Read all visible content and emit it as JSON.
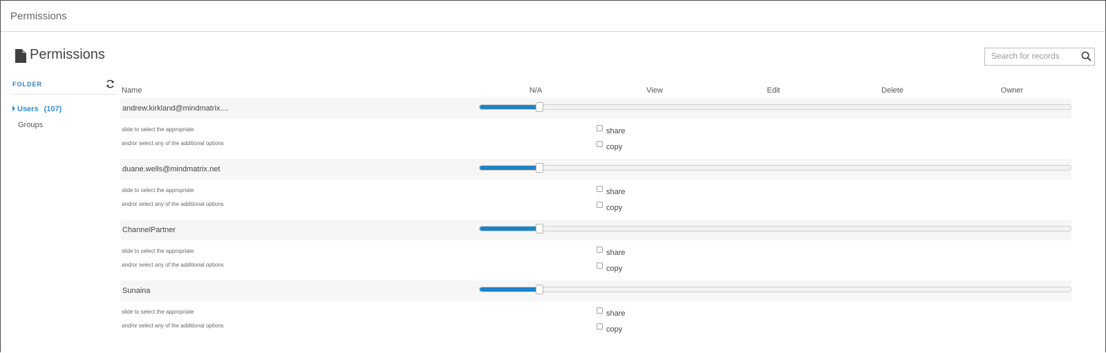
{
  "window": {
    "title": "Permissions"
  },
  "page": {
    "title": "Permissions",
    "icon": "document-icon"
  },
  "search": {
    "placeholder": "Search for records",
    "value": "",
    "icon": "search-icon"
  },
  "sidebar": {
    "header": "FOLDER",
    "refresh_icon": "refresh-icon",
    "items": [
      {
        "label": "Users",
        "count": "(107)",
        "active": true
      },
      {
        "label": "Groups",
        "active": false
      }
    ]
  },
  "table": {
    "columns": {
      "name": "Name",
      "levels": [
        "N/A",
        "View",
        "Edit",
        "Delete",
        "Owner"
      ]
    },
    "hint1": "slide to select the appropriate",
    "hint2": "and/or select any of the additional options",
    "options": [
      "share",
      "copy"
    ],
    "rows": [
      {
        "name": "andrew.kirkland@mindmatrix....",
        "level_fraction": 0.1,
        "share": false,
        "copy": false
      },
      {
        "name": "duane.wells@mindmatrix.net",
        "level_fraction": 0.1,
        "share": false,
        "copy": false
      },
      {
        "name": "ChannelPartner",
        "level_fraction": 0.1,
        "share": false,
        "copy": false
      },
      {
        "name": "Sunaina",
        "level_fraction": 0.1,
        "share": false,
        "copy": false
      }
    ]
  },
  "colors": {
    "accent": "#1e83c6",
    "link": "#2d8fd0"
  }
}
